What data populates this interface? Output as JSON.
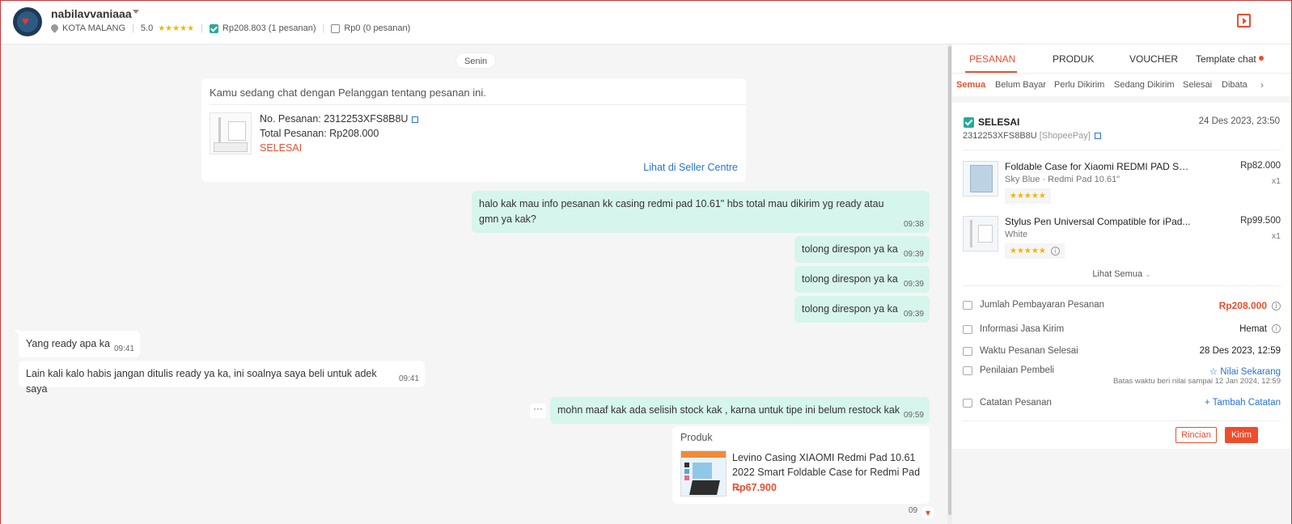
{
  "header": {
    "username": "nabilavvaniaaa",
    "location": "KOTA MALANG",
    "rating": "5.0",
    "stars": "★★★★★",
    "paid_total": "Rp208.803",
    "paid_orders": "(1 pesanan)",
    "unpaid_total": "Rp0",
    "unpaid_orders": "(0 pesanan)"
  },
  "chat": {
    "day_label": "Senin",
    "order_card": {
      "intro": "Kamu sedang chat dengan Pelanggan tentang pesanan ini.",
      "order_no": "No. Pesanan: 2312253XFS8B8U",
      "total": "Total Pesanan: Rp208.000",
      "status": "SELESAI",
      "link": "Lihat di Seller Centre"
    },
    "messages": [
      {
        "dir": "out",
        "text": "halo kak mau info pesanan kk casing redmi pad 10.61\" hbs total mau dikirim yg ready atau gmn ya kak?",
        "time": "09:38"
      },
      {
        "dir": "out",
        "text": "tolong direspon ya ka",
        "time": "09:39"
      },
      {
        "dir": "out",
        "text": "tolong direspon ya ka",
        "time": "09:39"
      },
      {
        "dir": "out",
        "text": "tolong direspon ya ka",
        "time": "09:39"
      },
      {
        "dir": "in",
        "text": "Yang ready apa ka",
        "time": "09:41"
      },
      {
        "dir": "in",
        "text": "Lain kali kalo habis jangan ditulis ready ya ka, ini soalnya saya beli untuk adek saya",
        "time": "09:41"
      },
      {
        "dir": "out",
        "text": "mohn maaf kak ada selisih stock kak , karna untuk tipe ini belum restock kak",
        "time": "09:59"
      }
    ],
    "more_label": "···",
    "product_card": {
      "label": "Produk",
      "name": "Levino Casing XIAOMI Redmi Pad 10.61 2022 Smart Foldable Case for Redmi Pad ...",
      "price": "Rp67.900"
    },
    "partial_time": "09"
  },
  "panel": {
    "tabs": [
      "PESANAN",
      "PRODUK",
      "VOUCHER",
      "Template chat"
    ],
    "subtabs": [
      "Semua",
      "Belum Bayar",
      "Perlu Dikirim",
      "Sedang Dikirim",
      "Selesai",
      "Dibata"
    ],
    "order": {
      "status": "SELESAI",
      "date": "24 Des 2023, 23:50",
      "order_no": "2312253XFS8B8U",
      "payment": "[ShopeePay]",
      "items": [
        {
          "name": "Foldable Case for Xiaomi REDMI PAD SE 2023...",
          "variant": "Sky Blue · Redmi Pad 10.61\"",
          "price": "Rp82.000",
          "qty": "x1",
          "stars": "★★★★★"
        },
        {
          "name": "Stylus Pen Universal Compatible for iPad...",
          "variant": "White",
          "price": "Rp99.500",
          "qty": "x1",
          "stars": "★★★★★"
        }
      ],
      "see_all": "Lihat Semua",
      "rows": [
        {
          "label": "Jumlah Pembayaran Pesanan",
          "value": "Rp208.000"
        },
        {
          "label": "Informasi Jasa Kirim",
          "value": "Hemat"
        },
        {
          "label": "Waktu Pesanan Selesai",
          "value": "28 Des 2023, 12:59"
        },
        {
          "label": "Penilaian Pembeli",
          "value": "Nilai Sekarang",
          "sub": "Batas waktu beri nilai sampai 12 Jan 2024, 12:59"
        },
        {
          "label": "Catatan Pesanan",
          "value": "Tambah Catatan"
        }
      ],
      "btn_detail": "Rincian",
      "btn_send": "Kirim"
    }
  }
}
